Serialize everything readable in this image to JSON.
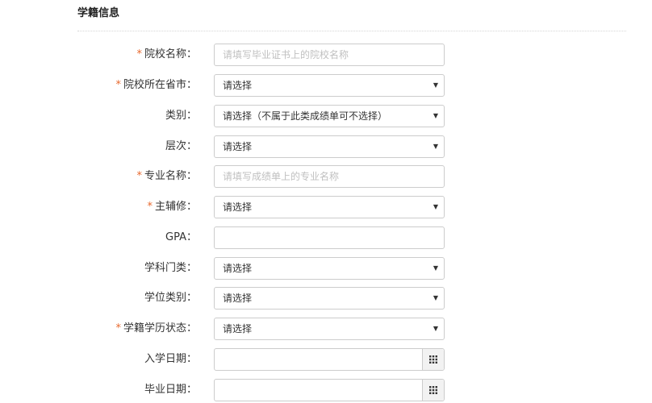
{
  "section": {
    "title": "学籍信息"
  },
  "form": {
    "fields": [
      {
        "key": "school_name",
        "required": true,
        "label": "院校名称：",
        "type": "text",
        "value": "",
        "placeholder": "请填写毕业证书上的院校名称"
      },
      {
        "key": "school_province",
        "required": true,
        "label": "院校所在省市：",
        "type": "select",
        "value": "请选择"
      },
      {
        "key": "category",
        "required": false,
        "label": "类别：",
        "type": "select",
        "value": "请选择（不属于此类成绩单可不选择）"
      },
      {
        "key": "level",
        "required": false,
        "label": "层次：",
        "type": "select",
        "value": "请选择"
      },
      {
        "key": "major_name",
        "required": true,
        "label": "专业名称：",
        "type": "text",
        "value": "",
        "placeholder": "请填写成绩单上的专业名称"
      },
      {
        "key": "major_minor",
        "required": true,
        "label": "主辅修：",
        "type": "select",
        "value": "请选择"
      },
      {
        "key": "gpa",
        "required": false,
        "label": "GPA：",
        "type": "text",
        "value": "",
        "placeholder": ""
      },
      {
        "key": "discipline",
        "required": false,
        "label": "学科门类：",
        "type": "select",
        "value": "请选择"
      },
      {
        "key": "degree_type",
        "required": false,
        "label": "学位类别：",
        "type": "select",
        "value": "请选择"
      },
      {
        "key": "status",
        "required": true,
        "label": "学籍学历状态：",
        "type": "select",
        "value": "请选择"
      },
      {
        "key": "enroll_date",
        "required": false,
        "label": "入学日期：",
        "type": "date",
        "value": ""
      },
      {
        "key": "grad_date",
        "required": false,
        "label": "毕业日期：",
        "type": "date",
        "value": ""
      }
    ],
    "required_mark": "*",
    "select_caret_icon": "caret-down-icon",
    "date_button_icon": "calendar-grid-icon"
  }
}
